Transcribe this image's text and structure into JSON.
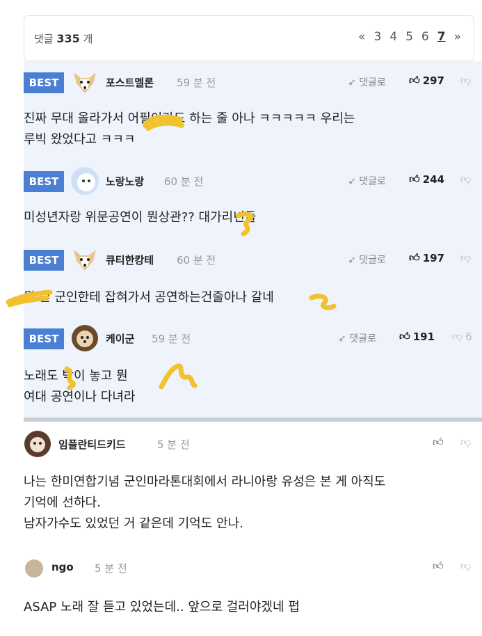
{
  "header": {
    "count_label": "댓글",
    "count_value": "335",
    "count_unit": "개",
    "pages": [
      "«",
      "3",
      "4",
      "5",
      "6",
      "7",
      "»"
    ],
    "current_page": "7"
  },
  "best_badge": "BEST",
  "reply_label": "댓글로",
  "best_comments": [
    {
      "nick": "포스트멜론",
      "time": "59 분 전",
      "likes": "297",
      "body": "진짜 무대 올라가서 어필이라도 하는 줄 아나 ㅋㅋㅋㅋㅋ 우리는\n루빅 왔었다고 ㅋㅋㅋ"
    },
    {
      "nick": "노랑노랑",
      "time": "60 분 전",
      "likes": "244",
      "body": "미성년자랑 위문공연이 뭔상관?? 대가리년들"
    },
    {
      "nick": "큐티한캉테",
      "time": "60 분 전",
      "likes": "197",
      "body": "뭘 뭔 군인한테 잡혀가서 공연하는건줄아나 갈네"
    },
    {
      "nick": "케이군",
      "time": "59 분 전",
      "likes": "191",
      "dislikes": "6",
      "body": "노래도 박이 놓고 뭔\n여대 공연이나 다녀라"
    }
  ],
  "comments": [
    {
      "nick": "임플란티드키드",
      "time": "5 분 전",
      "body": "나는 한미연합기념 군인마라톤대회에서 라니아랑 유성은 본 게 아직도\n기억에 선하다.\n남자가수도 있었던 거 같은데 기억도 안나."
    },
    {
      "nick": "ngo",
      "time": "5 분 전",
      "body": "ASAP 노래 잘 듣고 있었는데.. 앞으로 걸러야겠네 펍"
    }
  ]
}
